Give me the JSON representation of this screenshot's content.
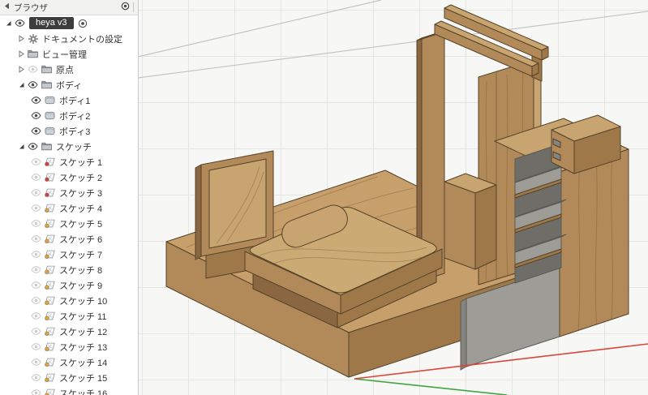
{
  "browser": {
    "title": "ブラウザ",
    "tree": [
      {
        "id": "heya-v3",
        "label": "heya v3",
        "level": 0,
        "arrow": "expanded",
        "eye": "on",
        "icon": null,
        "selected": true,
        "activate": true
      },
      {
        "id": "document-settings",
        "label": "ドキュメントの設定",
        "level": 1,
        "arrow": "collapsed",
        "eye": null,
        "icon": "gear"
      },
      {
        "id": "named-views",
        "label": "ビュー管理",
        "level": 1,
        "arrow": "collapsed",
        "eye": null,
        "icon": "folder"
      },
      {
        "id": "origin",
        "label": "原点",
        "level": 1,
        "arrow": "collapsed",
        "eye": "off",
        "icon": "folder"
      },
      {
        "id": "bodies",
        "label": "ボディ",
        "level": 1,
        "arrow": "expanded",
        "eye": "on",
        "icon": "folder"
      },
      {
        "id": "body-1",
        "label": "ボディ1",
        "level": 2,
        "eye": "on",
        "icon": "body"
      },
      {
        "id": "body-2",
        "label": "ボディ2",
        "level": 2,
        "eye": "on",
        "icon": "body"
      },
      {
        "id": "body-3",
        "label": "ボディ3",
        "level": 2,
        "eye": "on",
        "icon": "body"
      },
      {
        "id": "sketches",
        "label": "スケッチ",
        "level": 1,
        "arrow": "expanded",
        "eye": "on",
        "icon": "folder"
      },
      {
        "id": "sketch-1",
        "label": "スケッチ 1",
        "level": 2,
        "eye": "off",
        "icon": "sketch-locked"
      },
      {
        "id": "sketch-2",
        "label": "スケッチ 2",
        "level": 2,
        "eye": "off",
        "icon": "sketch-locked"
      },
      {
        "id": "sketch-3",
        "label": "スケッチ 3",
        "level": 2,
        "eye": "off",
        "icon": "sketch-locked"
      },
      {
        "id": "sketch-4",
        "label": "スケッチ 4",
        "level": 2,
        "eye": "off",
        "icon": "sketch"
      },
      {
        "id": "sketch-5",
        "label": "スケッチ 5",
        "level": 2,
        "eye": "off",
        "icon": "sketch"
      },
      {
        "id": "sketch-6",
        "label": "スケッチ 6",
        "level": 2,
        "eye": "off",
        "icon": "sketch"
      },
      {
        "id": "sketch-7",
        "label": "スケッチ 7",
        "level": 2,
        "eye": "off",
        "icon": "sketch"
      },
      {
        "id": "sketch-8",
        "label": "スケッチ 8",
        "level": 2,
        "eye": "off",
        "icon": "sketch"
      },
      {
        "id": "sketch-9",
        "label": "スケッチ 9",
        "level": 2,
        "eye": "off",
        "icon": "sketch"
      },
      {
        "id": "sketch-10",
        "label": "スケッチ 10",
        "level": 2,
        "eye": "off",
        "icon": "sketch"
      },
      {
        "id": "sketch-11",
        "label": "スケッチ 11",
        "level": 2,
        "eye": "off",
        "icon": "sketch"
      },
      {
        "id": "sketch-12",
        "label": "スケッチ 12",
        "level": 2,
        "eye": "off",
        "icon": "sketch"
      },
      {
        "id": "sketch-13",
        "label": "スケッチ 13",
        "level": 2,
        "eye": "off",
        "icon": "sketch"
      },
      {
        "id": "sketch-14",
        "label": "スケッチ 14",
        "level": 2,
        "eye": "off",
        "icon": "sketch"
      },
      {
        "id": "sketch-15",
        "label": "スケッチ 15",
        "level": 2,
        "eye": "off",
        "icon": "sketch"
      },
      {
        "id": "sketch-16",
        "label": "スケッチ 16",
        "level": 2,
        "eye": "off",
        "icon": "sketch"
      }
    ]
  },
  "viewport": {
    "model_parts": [
      "room-base",
      "bed",
      "pillow",
      "tv-panel",
      "partition-panel-left",
      "partition-panel-right",
      "hanger-rails",
      "middle-cabinet",
      "shelf-pedestal",
      "shelf-unit",
      "right-column",
      "wall-cube"
    ]
  },
  "palette": {
    "vp_bg": "#f7f7f5",
    "grid": "#e5e5e2",
    "persp_line": "#c4c4c1",
    "wood_top": "#c79f6b",
    "wood_light": "#c8a470",
    "wood_mid": "#b28a5a",
    "wood_dark": "#9e7849",
    "wood_deep": "#8a6740",
    "wood_sheet": "#ccaa74",
    "outline": "#55432a",
    "gray_light": "#bcbcb8",
    "gray_mid": "#9d9c97",
    "gray_dark": "#84837d",
    "gray_deep": "#6e6d67",
    "axis_x": "#d9473b",
    "axis_y": "#3fa43f",
    "panel_border": "#c9c9c9",
    "selected_bg": "#3d3d3d",
    "selected_fg": "#ffffff"
  }
}
